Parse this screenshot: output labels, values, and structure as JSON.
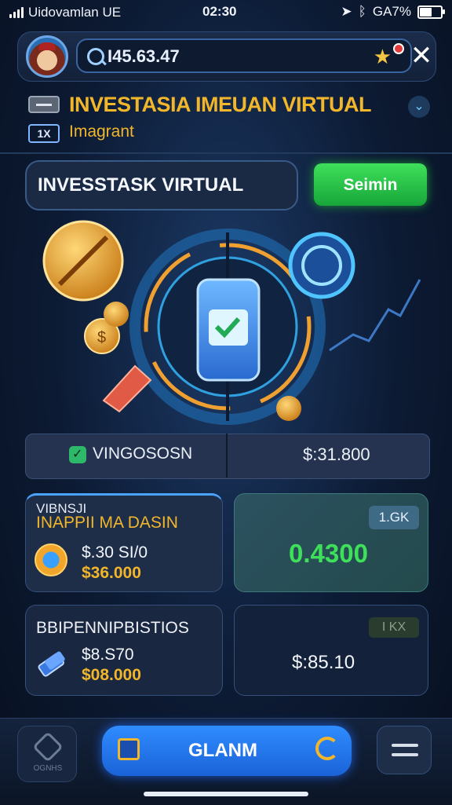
{
  "status_bar": {
    "carrier": "Uidovamlan UE",
    "time": "02:30",
    "battery": "GA7%",
    "battery_level": 0.67
  },
  "header": {
    "search_value": "I45.63.47",
    "close_glyph": "✕"
  },
  "app": {
    "title": "INVESTASIA IMEUAN VIRTUAL",
    "subtitle": "Imagrant",
    "tag": "1X"
  },
  "panel": {
    "title": "INVESSTASK VIRTUAL",
    "button_label": "Seimin"
  },
  "stats": {
    "left_label": "VINGOSOSN",
    "right_value": "$:31.800"
  },
  "cards": {
    "c1": {
      "head_line1": "VIBNSJI",
      "head_line2": "INAPPII MA DASIN",
      "value1": "$.30 SI/0",
      "value2": "$36.000"
    },
    "c2": {
      "pill": "1.GK",
      "value": "0.4300"
    },
    "c3": {
      "head": "BBIPENNIPBISTIOS",
      "value1": "$8.S70",
      "value2": "$08.000"
    },
    "c4": {
      "pill": "I KX",
      "value": "$:85.10"
    }
  },
  "bottom_nav": {
    "home_label": "OGNHS",
    "main_label": "GLANM"
  },
  "colors": {
    "accent_gold": "#f2b62b",
    "accent_green": "#3ee05a",
    "accent_blue": "#2f8cff",
    "background": "#0c1a33"
  }
}
